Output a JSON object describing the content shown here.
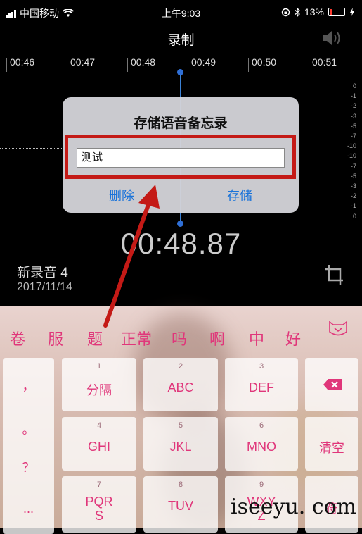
{
  "status": {
    "carrier": "中国移动",
    "time": "上午9:03",
    "battery": "13%"
  },
  "header": {
    "title": "录制"
  },
  "timeline": {
    "ticks": [
      "00:46",
      "00:47",
      "00:48",
      "00:49",
      "00:50",
      "00:51"
    ]
  },
  "db_scale": [
    "0",
    "-1",
    "-2",
    "-3",
    "-5",
    "-7",
    "-10",
    "-10",
    "-7",
    "-5",
    "-3",
    "-2",
    "-1",
    "0"
  ],
  "dialog": {
    "title": "存储语音备忘录",
    "input_value": "测试",
    "delete_label": "删除",
    "save_label": "存储"
  },
  "recording": {
    "timer": "00:48.87",
    "name": "新录音 4",
    "date": "2017/11/14"
  },
  "keyboard": {
    "candidates": [
      "卷",
      "服",
      "题",
      "正常",
      "吗",
      "啊",
      "中",
      "好"
    ],
    "punctuation": [
      "，",
      "。",
      "？",
      "..."
    ],
    "keys": [
      {
        "num": "1",
        "label": "分隔"
      },
      {
        "num": "2",
        "label": "ABC"
      },
      {
        "num": "3",
        "label": "DEF"
      },
      {
        "num": "4",
        "label": "GHI"
      },
      {
        "num": "5",
        "label": "JKL"
      },
      {
        "num": "6",
        "label": "MNO"
      },
      {
        "num": "7",
        "label": "PQR\nS"
      },
      {
        "num": "8",
        "label": "TUV"
      },
      {
        "num": "9",
        "label": "WXY\nZ"
      }
    ],
    "clear_label": "清空",
    "row4_right": "符"
  },
  "watermark": "iseeyu. com",
  "colors": {
    "accent": "#1a73d9",
    "highlight": "#c41a16",
    "keyboard_text": "#e0367a"
  }
}
